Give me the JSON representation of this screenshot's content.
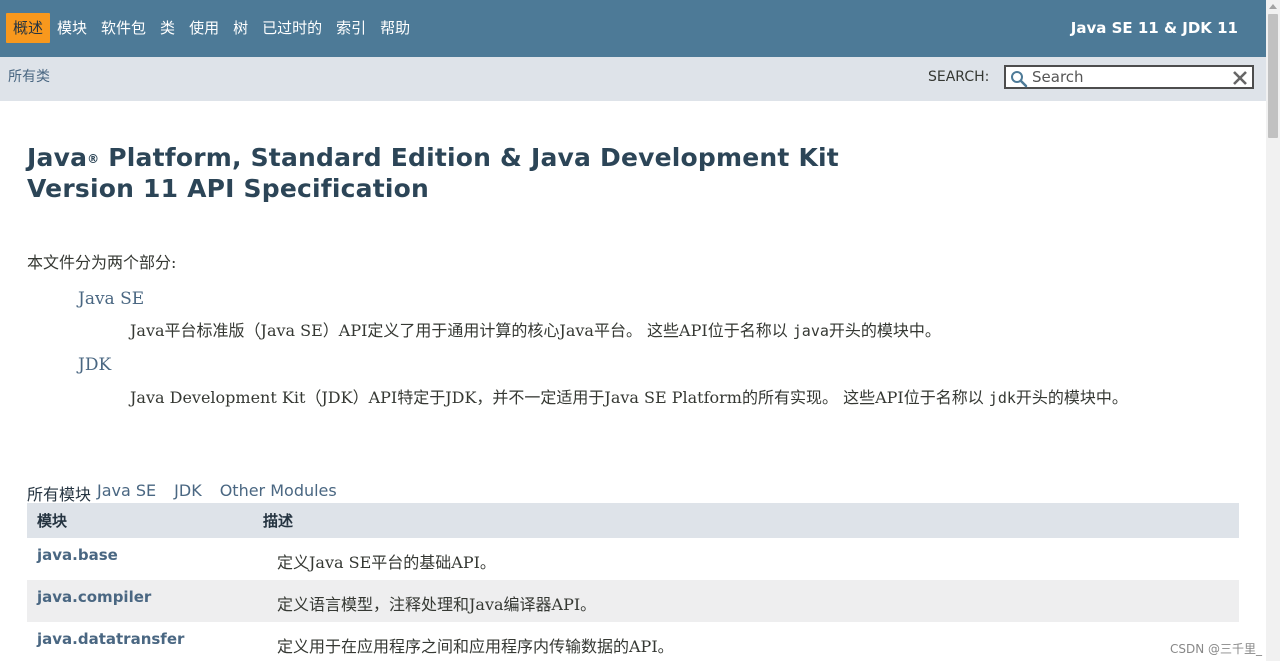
{
  "nav": {
    "items": [
      {
        "label": "概述",
        "active": true
      },
      {
        "label": "模块",
        "active": false
      },
      {
        "label": "软件包",
        "active": false
      },
      {
        "label": "类",
        "active": false
      },
      {
        "label": "使用",
        "active": false
      },
      {
        "label": "树",
        "active": false
      },
      {
        "label": "已过时的",
        "active": false
      },
      {
        "label": "索引",
        "active": false
      },
      {
        "label": "帮助",
        "active": false
      }
    ],
    "brand": "Java SE 11 & JDK 11"
  },
  "subnav": {
    "all_classes": "所有类",
    "search_label": "SEARCH:",
    "search_placeholder": "Search"
  },
  "title": {
    "line1_pre": "Java",
    "reg": "®",
    "line1_post": " Platform, Standard Edition & Java Development Kit",
    "line2": "Version 11 API Specification"
  },
  "intro": "本文件分为两个部分:",
  "sections": [
    {
      "term": "Java SE",
      "desc_pre": "Java平台标准版（Java SE）API定义了用于通用计算的核心Java平台。 这些API位于名称以 ",
      "code": "java",
      "desc_post": "开头的模块中。"
    },
    {
      "term": "JDK",
      "desc_pre": "Java Development Kit（JDK）API特定于JDK，并不一定适用于Java SE Platform的所有实现。 这些API位于名称以 ",
      "code": "jdk",
      "desc_post": "开头的模块中。"
    }
  ],
  "module_tabs": [
    {
      "label": "所有模块",
      "active": true
    },
    {
      "label": "Java SE",
      "active": false
    },
    {
      "label": "JDK",
      "active": false
    },
    {
      "label": "Other Modules",
      "active": false
    }
  ],
  "table": {
    "headers": [
      "模块",
      "描述"
    ],
    "rows": [
      {
        "module": "java.base",
        "desc": "定义Java SE平台的基础API。"
      },
      {
        "module": "java.compiler",
        "desc": "定义语言模型，注释处理和Java编译器API。"
      },
      {
        "module": "java.datatransfer",
        "desc": "定义用于在应用程序之间和应用程序内传输数据的API。"
      }
    ]
  },
  "watermark": "CSDN @三千里_",
  "colors": {
    "nav_bg": "#4d7a97",
    "active_tab": "#f8981d",
    "subnav_bg": "#dee3e9",
    "link": "#4a6782",
    "title": "#2c4557"
  }
}
